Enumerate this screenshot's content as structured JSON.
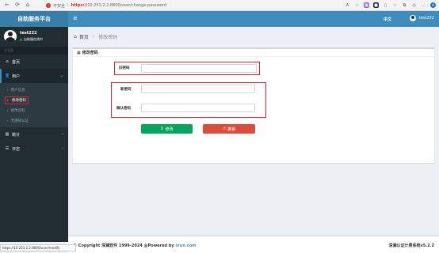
{
  "browser": {
    "insecure_label": "不安全",
    "url_scheme": "https://",
    "url_rest": "10.253.2.2:8800/user/change-password",
    "status_url": "https://10.253.2.2:8800/user/modify"
  },
  "header": {
    "brand": "自助服务平台",
    "lang": "中文",
    "user": "test222"
  },
  "sidebar": {
    "username": "test222",
    "status": "自助服在线中",
    "section_label": "主导航",
    "items": [
      {
        "label": "首页",
        "icon": "home-icon"
      },
      {
        "label": "用户",
        "icon": "user-icon"
      },
      {
        "label": "统计",
        "icon": "chart-icon"
      },
      {
        "label": "日志",
        "icon": "list-icon"
      }
    ],
    "submenu": [
      {
        "label": "用户信息"
      },
      {
        "label": "修改密码"
      },
      {
        "label": "修改资料"
      },
      {
        "label": "无感知认证"
      }
    ]
  },
  "breadcrumb": {
    "home": "首页",
    "current": "修改密码"
  },
  "form": {
    "title": "修改密码",
    "old_password_label": "旧密码",
    "new_password_label": "新密码",
    "confirm_password_label": "确认密码",
    "save_label": "修改",
    "cancel_label": "撤销"
  },
  "footer": {
    "copyright_prefix": "© Copyright 深澜软件 1999-2024 @Powered by",
    "link": "srun.com",
    "right": "深澜认证计费系统v5.2.2"
  }
}
